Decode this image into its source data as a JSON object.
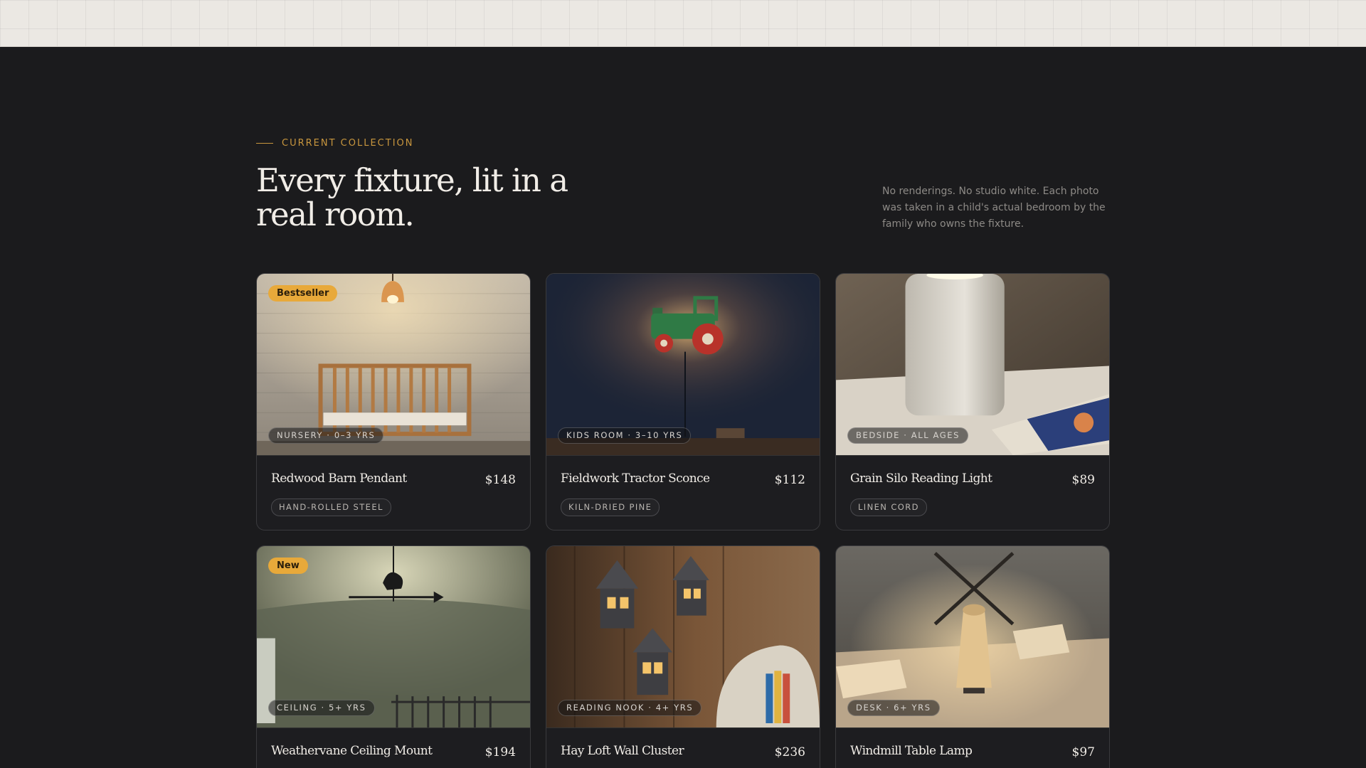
{
  "header": {
    "eyebrow": "CURRENT COLLECTION",
    "headline": "Every fixture, lit in a real room.",
    "intro": "No renderings. No studio white. Each photo was taken in a child's actual bedroom by the family who owns the fixture."
  },
  "colors": {
    "accent": "#c8963e",
    "badge": "#e8a93a",
    "background": "#1b1b1d",
    "topband": "#ebe8e3"
  },
  "products": [
    {
      "name": "Redwood Barn Pendant",
      "price": "$148",
      "room": "NURSERY · 0–3 YRS",
      "material": "HAND-ROLLED STEEL",
      "badge": "Bestseller",
      "photo": "pendant-crib-photo"
    },
    {
      "name": "Fieldwork Tractor Sconce",
      "price": "$112",
      "room": "KIDS ROOM · 3–10 YRS",
      "material": "KILN-DRIED PINE",
      "badge": "",
      "photo": "tractor-sconce-photo"
    },
    {
      "name": "Grain Silo Reading Light",
      "price": "$89",
      "room": "BEDSIDE · ALL AGES",
      "material": "LINEN CORD",
      "badge": "",
      "photo": "silo-lamp-photo"
    },
    {
      "name": "Weathervane Ceiling Mount",
      "price": "$194",
      "room": "CEILING · 5+ YRS",
      "material": "",
      "badge": "New",
      "photo": "weathervane-photo"
    },
    {
      "name": "Hay Loft Wall Cluster",
      "price": "$236",
      "room": "READING NOOK · 4+ YRS",
      "material": "",
      "badge": "",
      "photo": "house-lanterns-photo"
    },
    {
      "name": "Windmill Table Lamp",
      "price": "$97",
      "room": "DESK · 6+ YRS",
      "material": "",
      "badge": "",
      "photo": "windmill-lamp-photo"
    }
  ]
}
